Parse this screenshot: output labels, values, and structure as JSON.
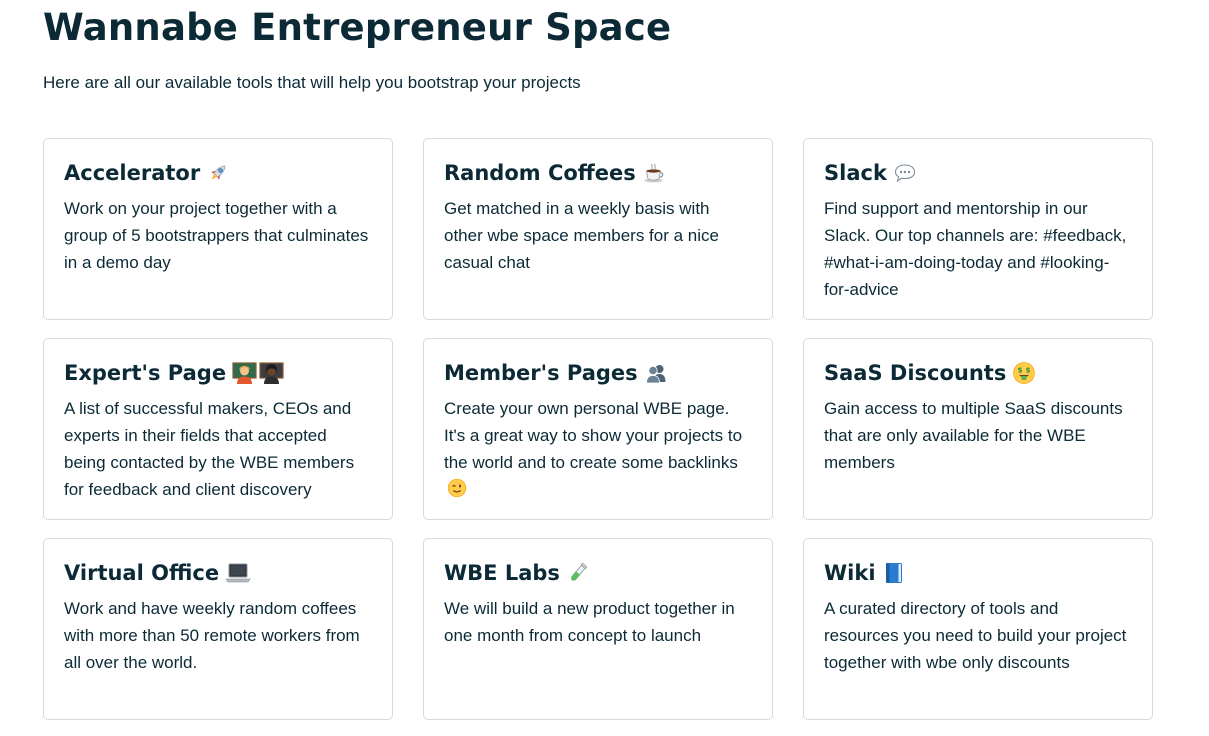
{
  "header": {
    "title": "Wannabe Entrepreneur Space",
    "subtitle": "Here are all our available tools that will help you bootstrap your projects"
  },
  "cards": [
    {
      "title": "Accelerator",
      "icon": "rocket-icon",
      "description": "Work on your project together with a group of 5 bootstrappers that culminates in a demo day"
    },
    {
      "title": "Random Coffees",
      "icon": "coffee-cup-icon",
      "description": "Get matched in a weekly basis with other wbe space members for a nice casual chat"
    },
    {
      "title": "Slack",
      "icon": "speech-bubble-icon",
      "description": "Find support and mentorship in our Slack. Our top channels are: #feedback, #what-i-am-doing-today and #looking-for-advice"
    },
    {
      "title": "Expert's Page",
      "icon": "teachers-icon",
      "description": "A list of successful makers, CEOs and experts in their fields that accepted being contacted by the WBE members for feedback and client discovery"
    },
    {
      "title": "Member's Pages",
      "icon": "people-silhouette-icon",
      "description": "Create your own personal WBE page. It's a great way to show your projects to the world and to create some backlinks",
      "trailing_icon": "winking-face-icon"
    },
    {
      "title": "SaaS Discounts",
      "icon": "money-mouth-face-icon",
      "description": "Gain access to multiple SaaS discounts that are only available for the WBE members"
    },
    {
      "title": "Virtual Office",
      "icon": "laptop-icon",
      "description": "Work and have weekly random coffees with more than 50 remote workers from all over the world."
    },
    {
      "title": "WBE Labs",
      "icon": "test-tube-icon",
      "description": "We will build a new product together in one month from concept to launch"
    },
    {
      "title": "Wiki",
      "icon": "blue-book-icon",
      "description": "A curated directory of tools and resources you need to build your project together with wbe only discounts"
    }
  ]
}
